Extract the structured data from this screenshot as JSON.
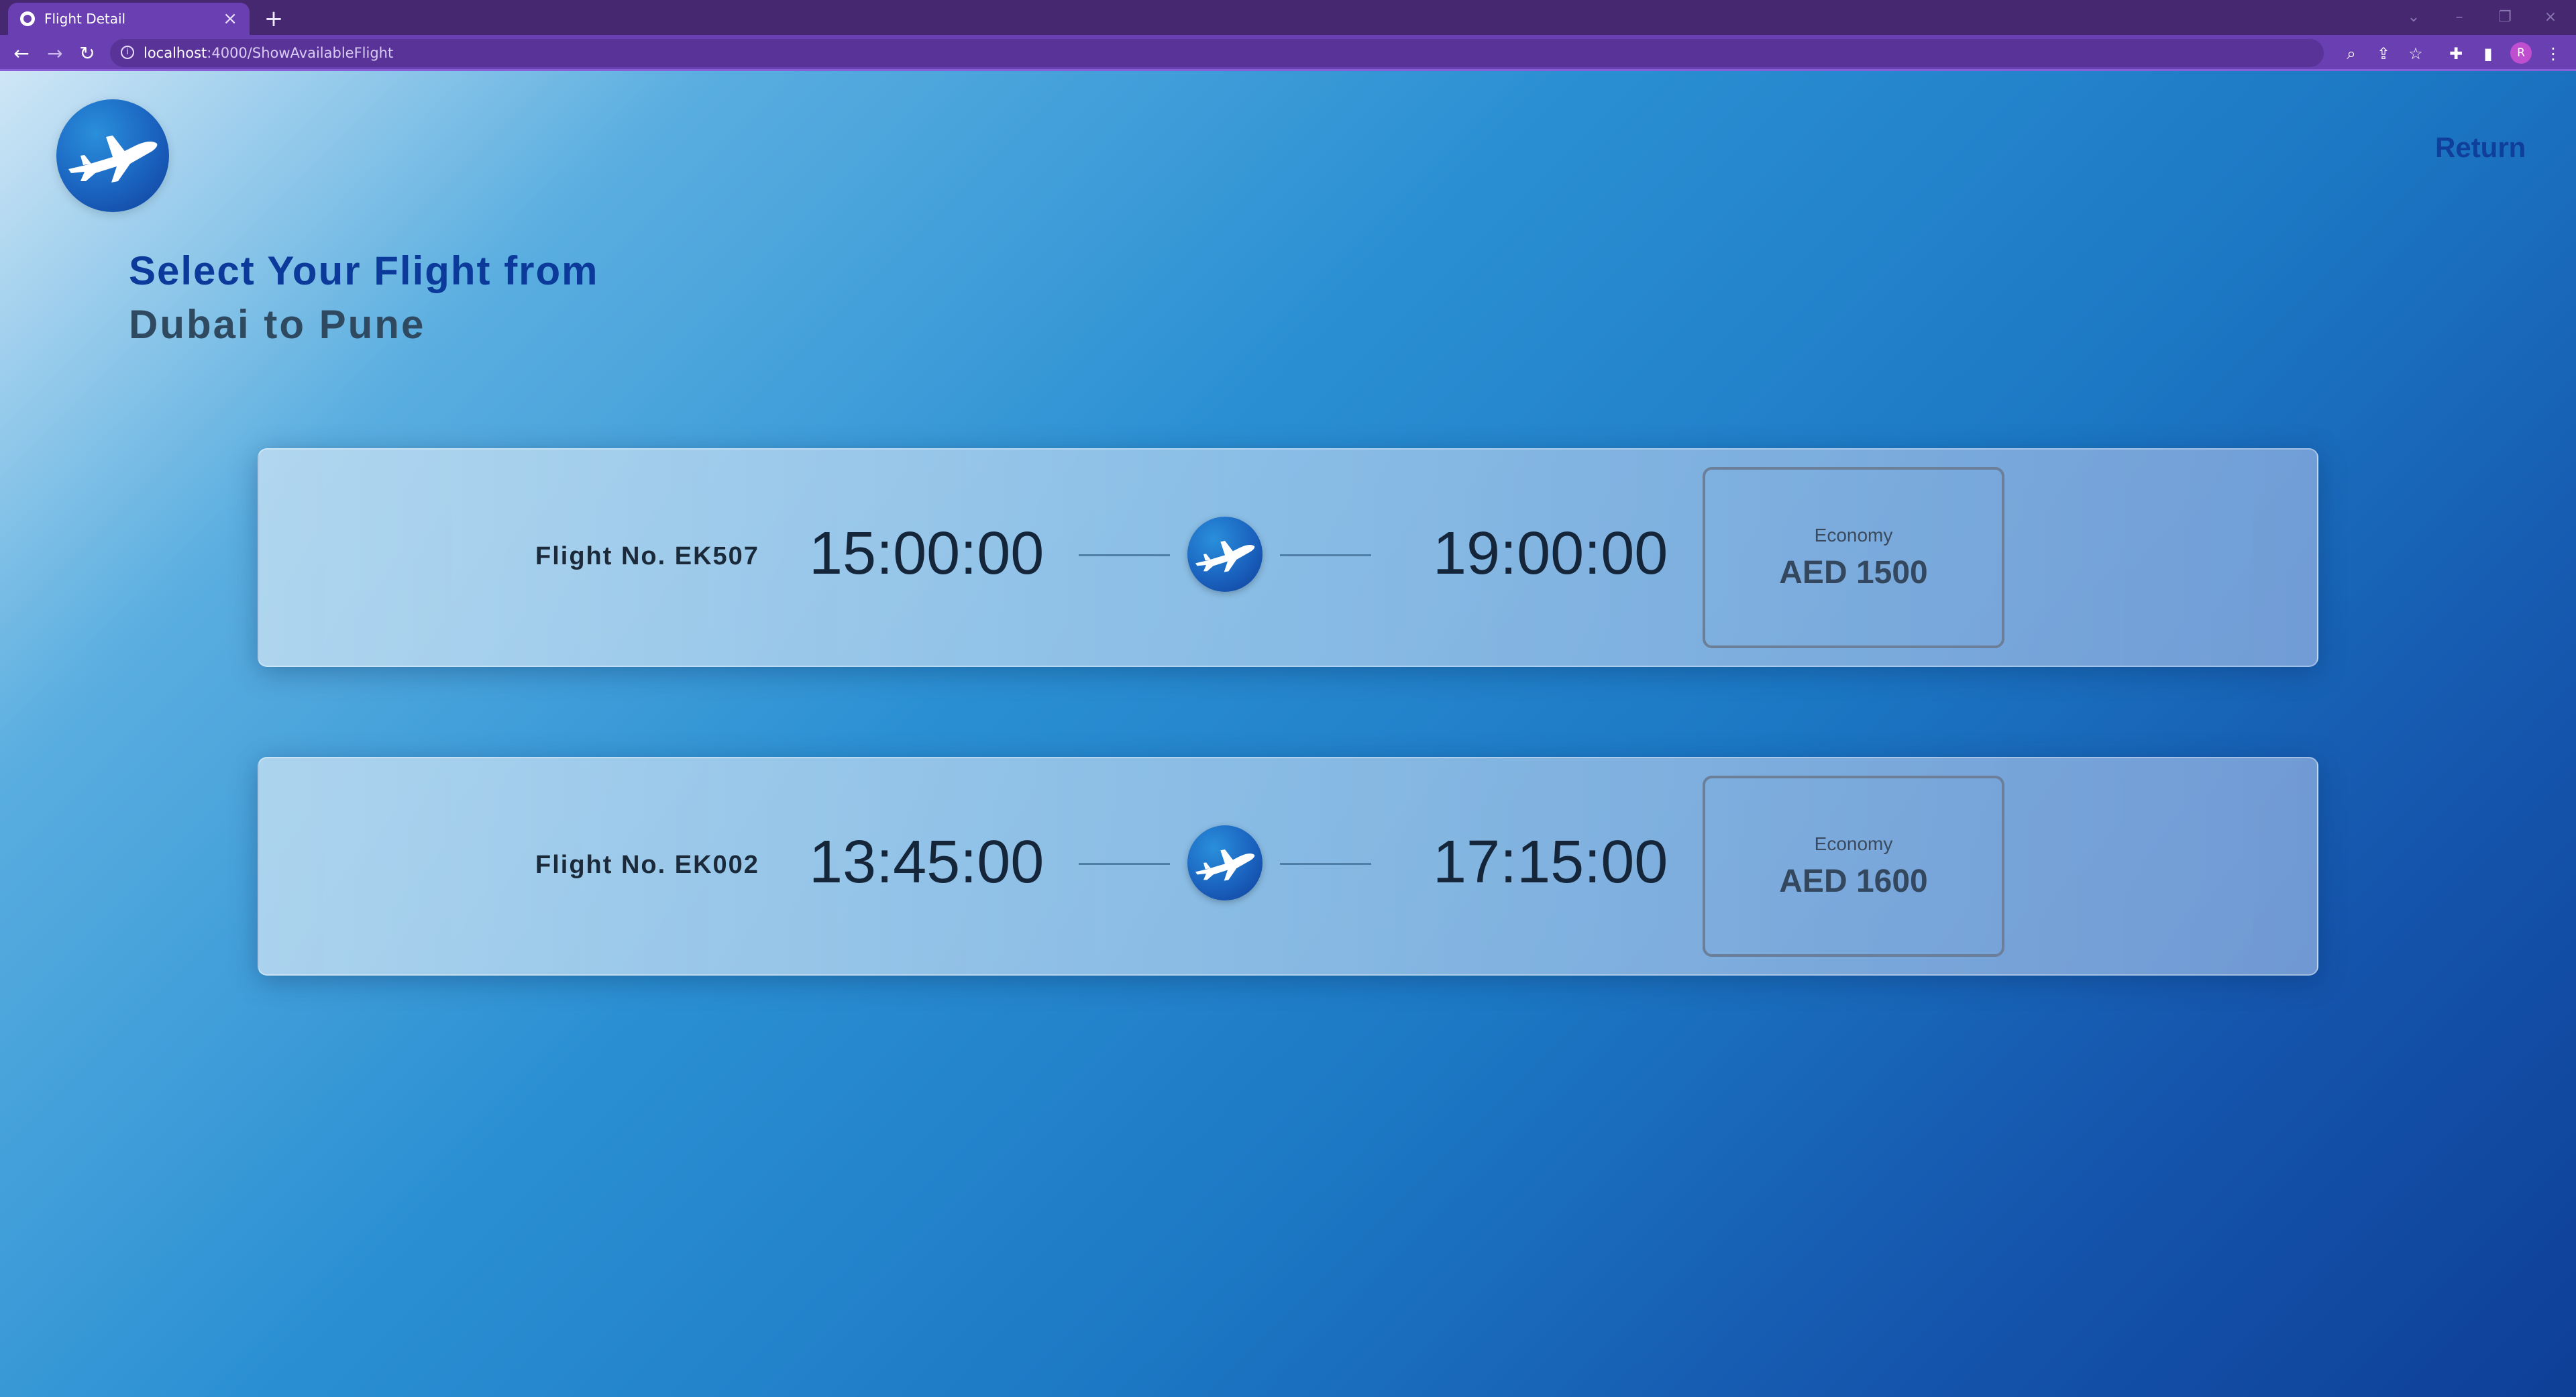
{
  "browser": {
    "tab_title": "Flight Detail",
    "tab_close": "×",
    "new_tab": "+",
    "url_host": "localhost",
    "url_path": ":4000/ShowAvailableFlight",
    "profile_initial": "R",
    "icons": [
      "back-icon",
      "forward-icon",
      "reload-icon",
      "info-icon",
      "zoom-icon",
      "share-icon",
      "star-icon",
      "extensions-icon",
      "sidebar-icon",
      "menu-icon"
    ]
  },
  "header": {
    "return_label": "Return"
  },
  "headline": {
    "line1": "Select Your Flight from",
    "line2": "Dubai to Pune"
  },
  "flights": [
    {
      "flight_no": "Flight No. EK507",
      "departure": "15:00:00",
      "arrival": "19:00:00",
      "fare_class": "Economy",
      "price": "AED 1500"
    },
    {
      "flight_no": "Flight No. EK002",
      "departure": "13:45:00",
      "arrival": "17:15:00",
      "fare_class": "Economy",
      "price": "AED 1600"
    }
  ],
  "colors": {
    "chrome": "#45286f",
    "toolbar": "#6a3fb1",
    "accent_blue": "#0f3f9a",
    "headline_dark": "#2f4a60"
  }
}
